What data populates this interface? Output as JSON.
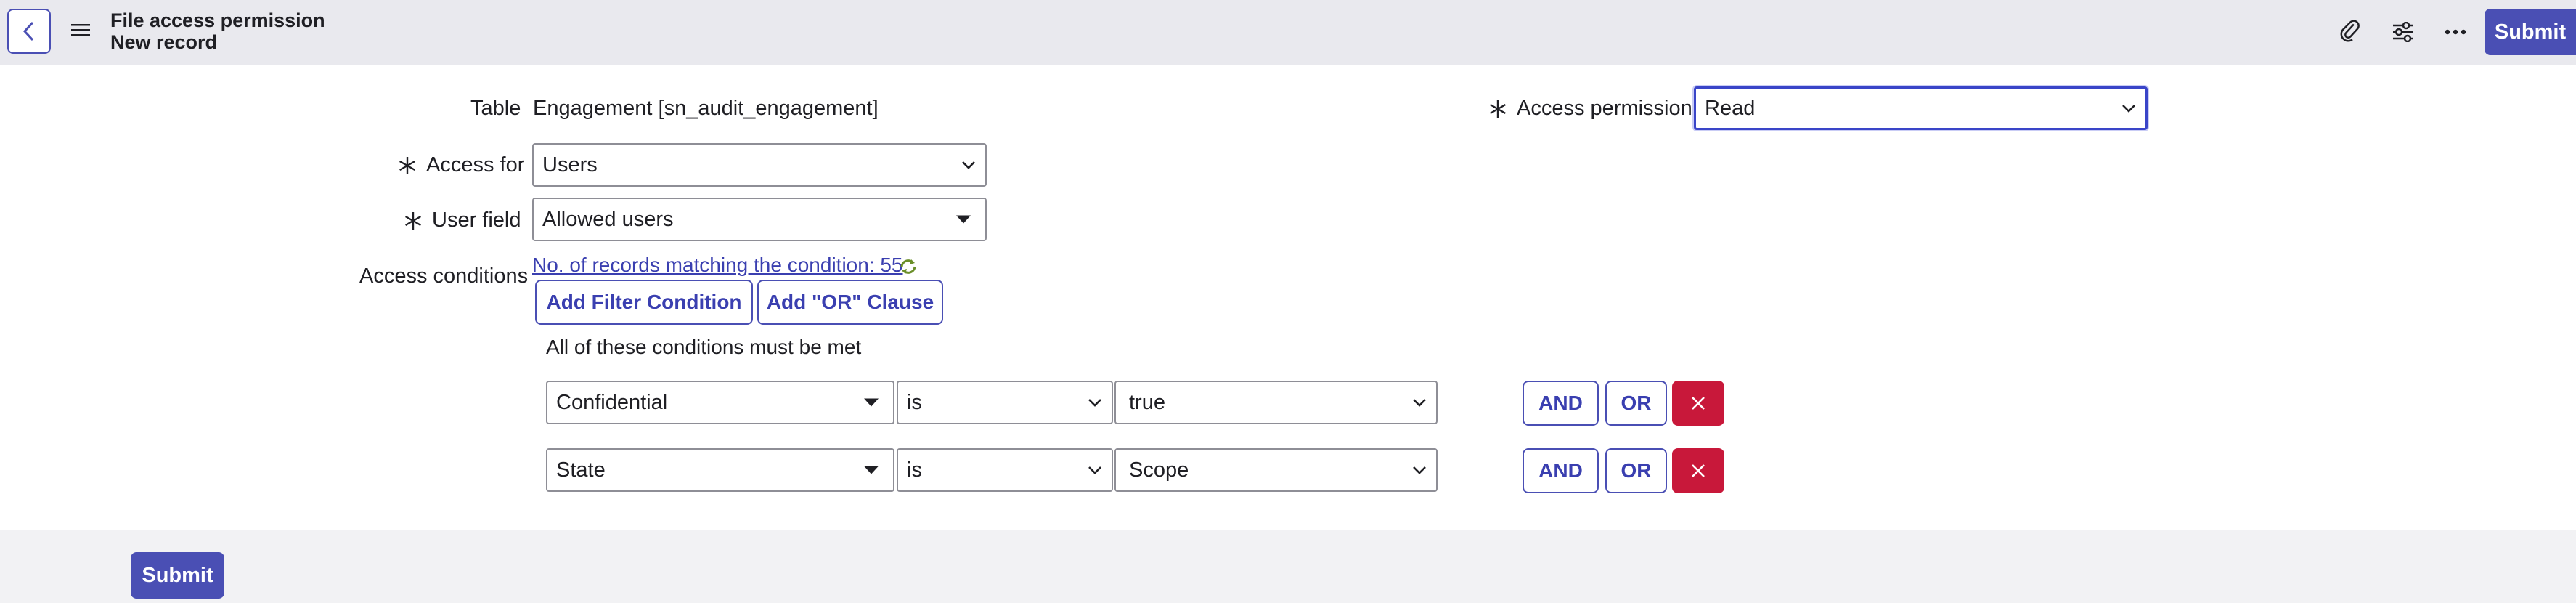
{
  "header": {
    "title": "File access permission",
    "subtitle": "New record",
    "submit_label": "Submit",
    "icons": [
      "back-icon",
      "menu-icon",
      "paperclip-icon",
      "settings-sliders-icon",
      "more-icon"
    ]
  },
  "form": {
    "table": {
      "label": "Table",
      "value": "Engagement [sn_audit_engagement]"
    },
    "access_permission": {
      "label": "Access permission",
      "value": "Read",
      "required": true
    },
    "access_for": {
      "label": "Access for",
      "value": "Users",
      "required": true
    },
    "user_field": {
      "label": "User field",
      "value": "Allowed users",
      "required": true
    },
    "access_conditions": {
      "label": "Access conditions",
      "records_link": "No. of records matching the condition: 55",
      "add_filter_label": "Add Filter Condition",
      "add_or_label": "Add \"OR\" Clause",
      "all_conditions_text": "All of these conditions must be met",
      "conditions": [
        {
          "field": "Confidential",
          "operator": "is",
          "value": "true",
          "and_label": "AND",
          "or_label": "OR"
        },
        {
          "field": "State",
          "operator": "is",
          "value": "Scope",
          "and_label": "AND",
          "or_label": "OR"
        }
      ]
    }
  },
  "footer": {
    "submit_label": "Submit"
  },
  "colors": {
    "accent": "#4a4fb4",
    "danger": "#c8183a",
    "header_bg": "#e9e9ee"
  }
}
